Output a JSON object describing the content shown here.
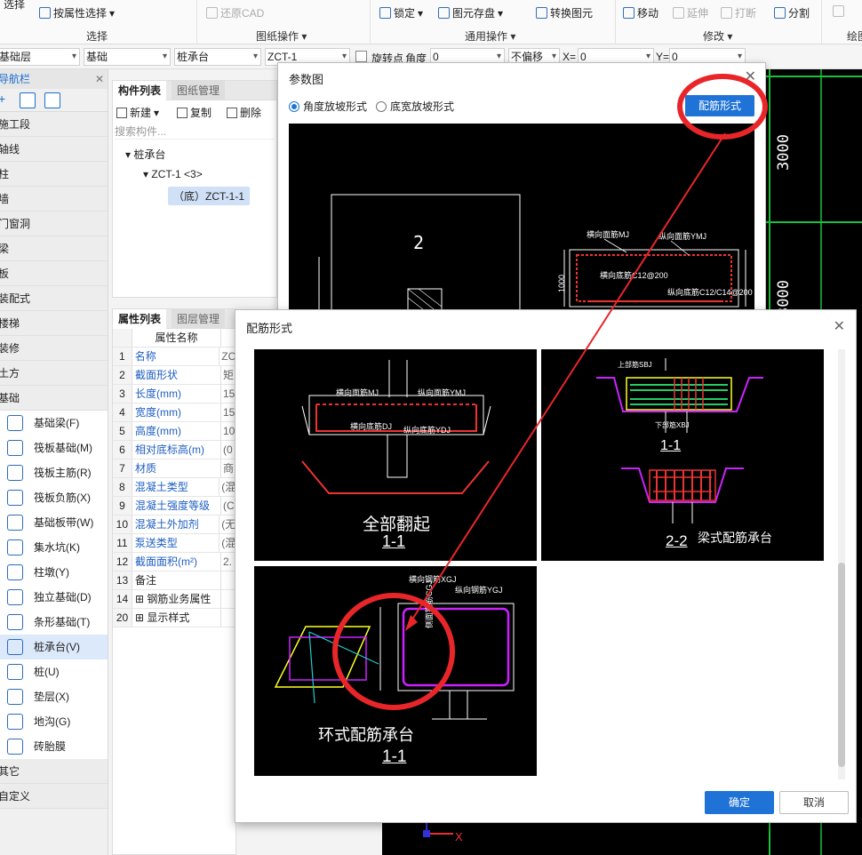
{
  "ribbon": {
    "select_top": "选择",
    "select_by_attr": "按属性选择",
    "group_select": "选择",
    "restore_cad": "还原CAD",
    "group_drawing": "图纸操作",
    "lock": "锁定",
    "save_element": "图元存盘",
    "convert_element": "转换图元",
    "group_common": "通用操作",
    "move": "移动",
    "extend": "延伸",
    "break": "打断",
    "split": "分割",
    "group_modify": "修改",
    "group_draw": "绘图"
  },
  "toolbar": {
    "floor": "基础层",
    "category": "基础",
    "type": "桩承台",
    "element": "ZCT-1",
    "rotate_label": "旋转点",
    "angle_label": "角度",
    "angle_value": "0",
    "offset": "不偏移",
    "x_label": "X=",
    "x_value": "0",
    "y_label": "Y=",
    "y_value": "0"
  },
  "nav": {
    "title": "导航栏",
    "categories_top": [
      "施工段",
      "轴线",
      "柱",
      "墙",
      "门窗洞",
      "梁",
      "板",
      "装配式",
      "楼梯",
      "装修",
      "土方",
      "基础"
    ],
    "sub_items": [
      "基础梁(F)",
      "筏板基础(M)",
      "筏板主筋(R)",
      "筏板负筋(X)",
      "基础板带(W)",
      "集水坑(K)",
      "柱墩(Y)",
      "独立基础(D)",
      "条形基础(T)",
      "桩承台(V)",
      "桩(U)",
      "垫层(X)",
      "地沟(G)",
      "砖胎膜"
    ],
    "selected_index": 9,
    "categories_bottom": [
      "其它",
      "自定义"
    ]
  },
  "component_panel": {
    "tab_active": "构件列表",
    "tab_other": "图纸管理",
    "new": "新建",
    "copy": "复制",
    "delete": "删除",
    "search_placeholder": "搜索构件...",
    "tree_root": "桩承台",
    "tree_child": "ZCT-1 <3>",
    "tree_leaf": "（底）ZCT-1-1"
  },
  "props_panel": {
    "tab_active": "属性列表",
    "tab_other": "图层管理",
    "header": "属性名称",
    "rows": [
      {
        "n": "1",
        "k": "名称",
        "v": "ZC",
        "blue": true
      },
      {
        "n": "2",
        "k": "截面形状",
        "v": "矩",
        "blue": true
      },
      {
        "n": "3",
        "k": "长度(mm)",
        "v": "15",
        "blue": true
      },
      {
        "n": "4",
        "k": "宽度(mm)",
        "v": "15",
        "blue": true
      },
      {
        "n": "5",
        "k": "高度(mm)",
        "v": "10",
        "blue": true
      },
      {
        "n": "6",
        "k": "相对底标高(m)",
        "v": "(0",
        "blue": true
      },
      {
        "n": "7",
        "k": "材质",
        "v": "商",
        "blue": true
      },
      {
        "n": "8",
        "k": "混凝土类型",
        "v": "(混",
        "blue": true
      },
      {
        "n": "9",
        "k": "混凝土强度等级",
        "v": "(C",
        "blue": true
      },
      {
        "n": "10",
        "k": "混凝土外加剂",
        "v": "(无",
        "blue": true
      },
      {
        "n": "11",
        "k": "泵送类型",
        "v": "(混",
        "blue": true
      },
      {
        "n": "12",
        "k": "截面面积(m²)",
        "v": "2.",
        "blue": true
      },
      {
        "n": "13",
        "k": "备注",
        "v": "",
        "blue": false
      },
      {
        "n": "14",
        "k": "钢筋业务属性",
        "v": "",
        "blue": false
      },
      {
        "n": "20",
        "k": "显示样式",
        "v": "",
        "blue": false
      }
    ]
  },
  "cad": {
    "dim1": "3000",
    "dim2": "3000",
    "axis_x": "X"
  },
  "dialog_params": {
    "title": "参数图",
    "radio1": "角度放坡形式",
    "radio2": "底宽放坡形式",
    "button": "配筋形式",
    "preview_num": "2",
    "lbl_mj": "横向面筋MJ",
    "lbl_ymj": "纵向面筋YMJ",
    "lbl_c12": "横向底筋C12@200",
    "lbl_c12b": "纵向底筋C12/C14@200",
    "lbl_1000": "1000"
  },
  "dialog_rebar": {
    "title": "配筋形式",
    "tile1_caption": "全部翻起",
    "tile1_sec": "1-1",
    "tile2_sec1": "1-1",
    "tile2_sec2": "2-2",
    "tile2_caption": "梁式配筋承台",
    "tile3_caption": "环式配筋承台",
    "tile3_sec": "1-1",
    "t3_xgj": "横向钢筋XGJ",
    "t3_ygj": "纵向钢筋YGJ",
    "t3_cgj": "侧面钢筋CGJ",
    "t1_mj": "横向面筋MJ",
    "t1_ymj": "纵向面筋YMJ",
    "t1_dj": "横向底筋DJ",
    "t1_ydj": "纵向底筋YDJ",
    "t2_sbj": "上部筋SBJ",
    "t2_xbj": "下部筋XBJ",
    "ok": "确定",
    "cancel": "取消"
  },
  "colors": {
    "accent": "#1f73d6",
    "annotation_red": "#e8262a"
  }
}
